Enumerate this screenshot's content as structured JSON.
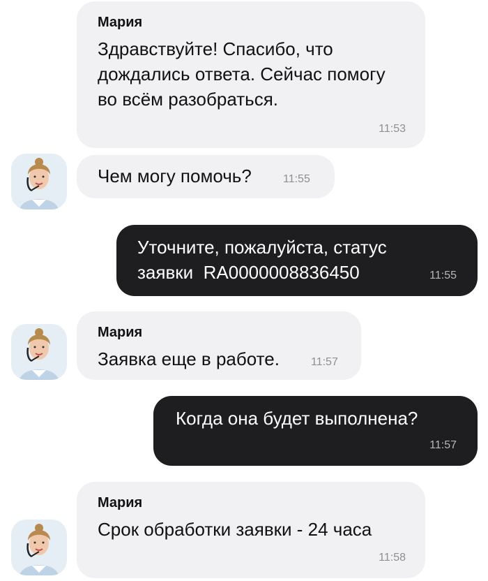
{
  "messages": [
    {
      "sender": "Мария",
      "text": "Здравствуйте! Спасибо, что дождались ответа. Сейчас помогу во всём разобраться.",
      "time": "11:53"
    },
    {
      "text": "Чем могу помочь?",
      "time": "11:55"
    },
    {
      "text": "Уточните, пожалуйста, статус заявки  RA0000008836450",
      "time": "11:55"
    },
    {
      "sender": "Мария",
      "text": "Заявка еще в работе.",
      "time": "11:57"
    },
    {
      "text": "Когда она будет выполнена?",
      "time": "11:57"
    },
    {
      "sender": "Мария",
      "text": "Срок обработки заявки - 24 часа",
      "time": "11:58"
    }
  ],
  "colors": {
    "incoming_bubble": "#f1f1f3",
    "outgoing_bubble": "#1e1e20",
    "timestamp": "#8e8e93"
  },
  "icons": {
    "agent_avatar": "operator-avatar-icon"
  }
}
